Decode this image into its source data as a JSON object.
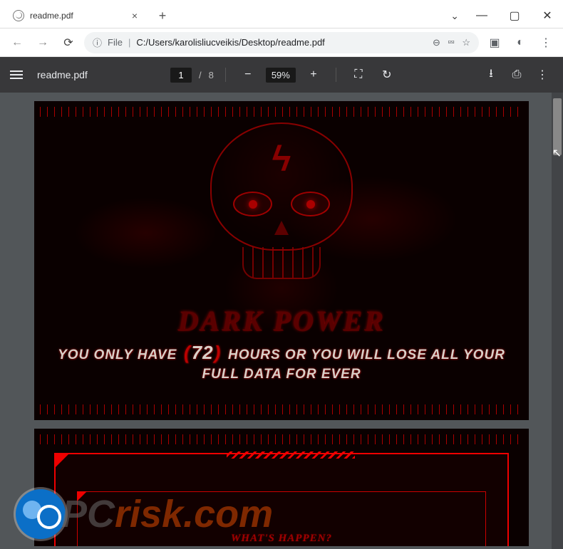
{
  "window": {
    "tab_title": "readme.pdf",
    "new_tab_glyph": "+",
    "close_glyph": "×",
    "minimize_glyph": "—",
    "maximize_glyph": "▢",
    "win_close_glyph": "✕",
    "chevron_glyph": "⌄"
  },
  "toolbar": {
    "back_glyph": "←",
    "forward_glyph": "→",
    "reload_glyph": "⟳",
    "file_info_glyph": "ⓘ",
    "file_label": "File",
    "url": "C:/Users/karolisliucveikis/Desktop/readme.pdf",
    "search_glyph": "⊖",
    "share_glyph": "⮹",
    "star_glyph": "☆",
    "ext_glyph": "▣",
    "profile_glyph": "◐",
    "menu_glyph": "⋮"
  },
  "pdfviewer": {
    "title": "readme.pdf",
    "page_current": "1",
    "page_sep": "/",
    "page_total": "8",
    "zoom_out_glyph": "−",
    "zoom_pct": "59%",
    "zoom_in_glyph": "+",
    "fit_glyph": "⛶",
    "rotate_glyph": "↻",
    "download_glyph": "⭳",
    "print_glyph": "⎙",
    "menu_glyph": "⋮"
  },
  "document": {
    "title": "DARK POWER",
    "warning_pre": "YOU ONLY HAVE",
    "hours": "72",
    "warning_post": "HOURS OR YOU WILL LOSE ALL YOUR FULL DATA FOR EVER",
    "page2_question": "WHAT'S HAPPEN?",
    "skull_bolt": "ϟ"
  },
  "watermark": {
    "pc": "PC",
    "risk": "risk.com"
  },
  "colors": {
    "pdfbar": "#38383a",
    "pdfbg": "#525659",
    "accent_red": "#c00000",
    "dark_red": "#5a0000"
  },
  "chart_data": null
}
